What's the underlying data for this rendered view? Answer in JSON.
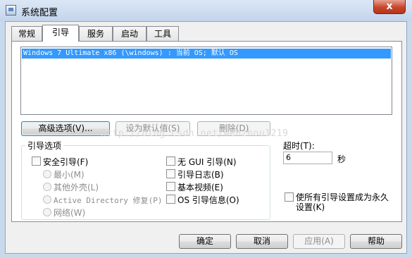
{
  "window": {
    "title": "系统配置",
    "close_glyph": "x"
  },
  "tabs": [
    {
      "label": "常规"
    },
    {
      "label": "引导",
      "active": true
    },
    {
      "label": "服务"
    },
    {
      "label": "启动"
    },
    {
      "label": "工具"
    }
  ],
  "os_list": {
    "entries": [
      "Windows 7 Ultimate x86 (\\windows) : 当前 OS; 默认 OS"
    ]
  },
  "buttons": {
    "advanced": "高级选项(V)...",
    "set_default": "设为默认值(S)",
    "delete": "删除(D)"
  },
  "boot_options": {
    "legend": "引导选项",
    "safe_boot": "安全引导(F)",
    "minimal": "最小(M)",
    "alternate_shell": "其他外壳(L)",
    "active_directory": "Active Directory 修复(P)",
    "network": "网络(W)",
    "no_gui": "无 GUI 引导(N)",
    "boot_log": "引导日志(B)",
    "base_video": "基本视频(E)",
    "os_info": "OS 引导信息(O)"
  },
  "timeout": {
    "label": "超时(T):",
    "value": "6",
    "unit": "秒"
  },
  "make_permanent": {
    "line1": "使所有引导设置成为永久",
    "line2": "设置(K)"
  },
  "footer": {
    "ok": "确定",
    "cancel": "取消",
    "apply": "应用(A)",
    "help": "帮助"
  },
  "watermark": "http://blog.csdn.net/wenzhou1219"
}
